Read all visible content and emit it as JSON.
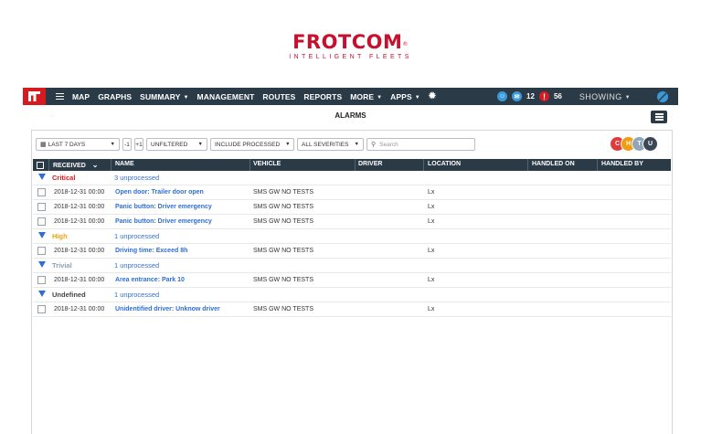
{
  "logo": {
    "title": "FROTCOM",
    "reg": "®",
    "subtitle": "INTELLIGENT FLEETS"
  },
  "nav": {
    "items": [
      {
        "label": "MAP",
        "caret": false
      },
      {
        "label": "GRAPHS",
        "caret": false
      },
      {
        "label": "SUMMARY",
        "caret": true
      },
      {
        "label": "MANAGEMENT",
        "caret": false
      },
      {
        "label": "ROUTES",
        "caret": false
      },
      {
        "label": "REPORTS",
        "caret": false
      },
      {
        "label": "MORE",
        "caret": true
      },
      {
        "label": "APPS",
        "caret": true
      }
    ],
    "caret_glyph": "▼",
    "gear_glyph": "✹",
    "messages_count": "12",
    "alarms_count": "56",
    "showing_label": "SHOWING"
  },
  "page": {
    "title": "ALARMS"
  },
  "filters": {
    "period": "LAST 7 DAYS",
    "step_minus": "-1",
    "step_plus": "+1",
    "filter_state": "UNFILTERED",
    "processed": "INCLUDE PROCESSED",
    "severities": "ALL SEVERITIES",
    "search_placeholder": "Search"
  },
  "avatars": [
    {
      "letter": "C",
      "color": "#e23a3a"
    },
    {
      "letter": "H",
      "color": "#f39c12"
    },
    {
      "letter": "T",
      "color": "#8fa7b8"
    },
    {
      "letter": "U",
      "color": "#3b4754"
    }
  ],
  "table": {
    "columns": {
      "received": "RECEIVED",
      "name": "NAME",
      "vehicle": "VEHICLE",
      "driver": "DRIVER",
      "location": "LOCATION",
      "handled_on": "HANDLED ON",
      "handled_by": "HANDLED BY"
    },
    "groups": [
      {
        "name": "Critical",
        "color": "#d71920",
        "count": "3 unprocessed",
        "rows": [
          {
            "received": "2018-12-31 00:00",
            "name": "Open door: Trailer door open",
            "vehicle": "SMS GW NO TESTS",
            "location": "Lx"
          },
          {
            "received": "2018-12-31 00:00",
            "name": "Panic button: Driver emergency",
            "vehicle": "SMS GW NO TESTS",
            "location": "Lx"
          },
          {
            "received": "2018-12-31 00:00",
            "name": "Panic button: Driver emergency",
            "vehicle": "SMS GW NO TESTS",
            "location": "Lx"
          }
        ]
      },
      {
        "name": "High",
        "color": "#f0a30a",
        "count": "1 unprocessed",
        "rows": [
          {
            "received": "2018-12-31 00:00",
            "name": "Driving time: Exceed 8h",
            "vehicle": "SMS GW NO TESTS",
            "location": "Lx"
          }
        ]
      },
      {
        "name": "Trivial",
        "color": "#8fa0ad",
        "count": "1 unprocessed",
        "rows": [
          {
            "received": "2018-12-31 00:00",
            "name": "Area entrance: Park 10",
            "vehicle": "SMS GW NO TESTS",
            "location": "Lx"
          }
        ]
      },
      {
        "name": "Undefined",
        "color": "#444444",
        "count": "1 unprocessed",
        "rows": [
          {
            "received": "2018-12-31 00:00",
            "name": "Unidentified driver: Unknow driver",
            "vehicle": "SMS GW NO TESTS",
            "location": "Lx"
          }
        ]
      }
    ]
  }
}
